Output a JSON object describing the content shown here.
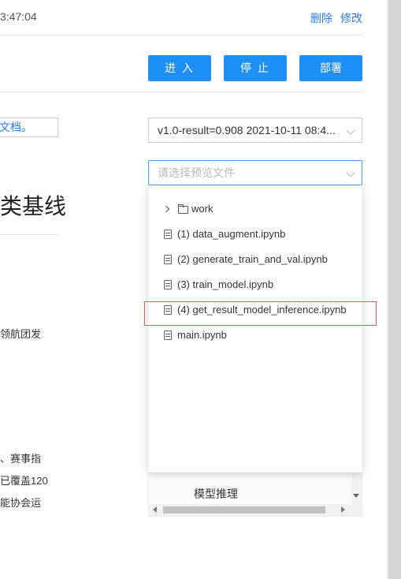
{
  "header": {
    "time": "3:47:04",
    "delete_label": "删除",
    "edit_label": "修改"
  },
  "actions": {
    "enter_label": "进 入",
    "stop_label": "停 止",
    "deploy_label": "部署"
  },
  "doc_link": "文档。",
  "version_select": {
    "value": "v1.0-result=0.908 2021-10-11 08:4..."
  },
  "preview_select": {
    "placeholder": "请选择预览文件"
  },
  "page_title_fragment": "类基线",
  "side_texts": {
    "line1": "领航团发",
    "line2": "、赛事指",
    "line3": "已覆盖120",
    "line4": "能协会运"
  },
  "file_tree": {
    "folder": "work",
    "files": [
      "(1) data_augment.ipynb",
      "(2) generate_train_and_val.ipynb",
      "(3) train_model.ipynb",
      "(4) get_result_model_inference.ipynb",
      "main.ipynb"
    ]
  },
  "table": {
    "cell": "模型推理"
  },
  "colors": {
    "accent": "#1e8ff5",
    "link": "#2c7be5",
    "highlight": "#e05a5a"
  },
  "icons": [
    "chevron-down-icon",
    "chevron-right-icon",
    "folder-icon",
    "file-icon"
  ]
}
